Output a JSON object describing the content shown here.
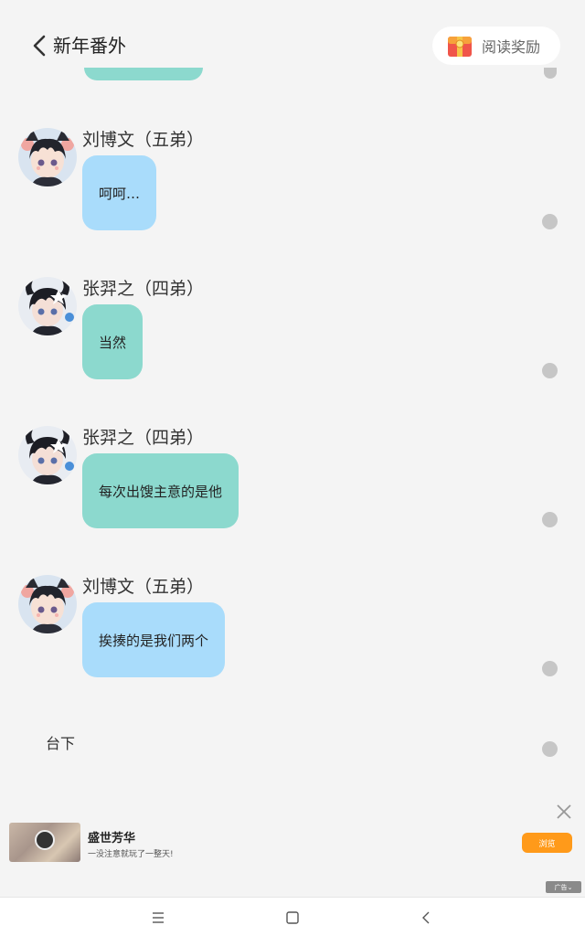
{
  "header": {
    "title": "新年番外",
    "back_icon": "chevron-left-icon",
    "reward": {
      "label": "阅读奖励",
      "icon": "gift-box-icon"
    }
  },
  "messages": [
    {
      "sender": "刘博文（五弟）",
      "text": "呵呵…",
      "bubble_color": "#a9dcfb",
      "avatar": "cat-ear-boy-avatar"
    },
    {
      "sender": "张羿之（四弟）",
      "text": "当然",
      "bubble_color": "#8cd9ce",
      "avatar": "horned-boy-avatar"
    },
    {
      "sender": "张羿之（四弟）",
      "text": "每次出馊主意的是他",
      "bubble_color": "#8cd9ce",
      "avatar": "horned-boy-avatar"
    },
    {
      "sender": "刘博文（五弟）",
      "text": "挨揍的是我们两个",
      "bubble_color": "#a9dcfb",
      "avatar": "cat-ear-boy-avatar"
    }
  ],
  "narration": "台下",
  "ad": {
    "title": "盛世芳华",
    "description": "一没注意就玩了一整天!",
    "button_label": "浏览",
    "badge": "广告",
    "close_icon": "close-icon"
  },
  "navbar": {
    "menu_icon": "menu-icon",
    "home_icon": "home-square-icon",
    "back_icon": "back-triangle-icon"
  },
  "colors": {
    "background": "#f4f4f4",
    "blue_bubble": "#a9dcfb",
    "green_bubble": "#8cd9ce",
    "ad_button": "#ff9a1a"
  }
}
